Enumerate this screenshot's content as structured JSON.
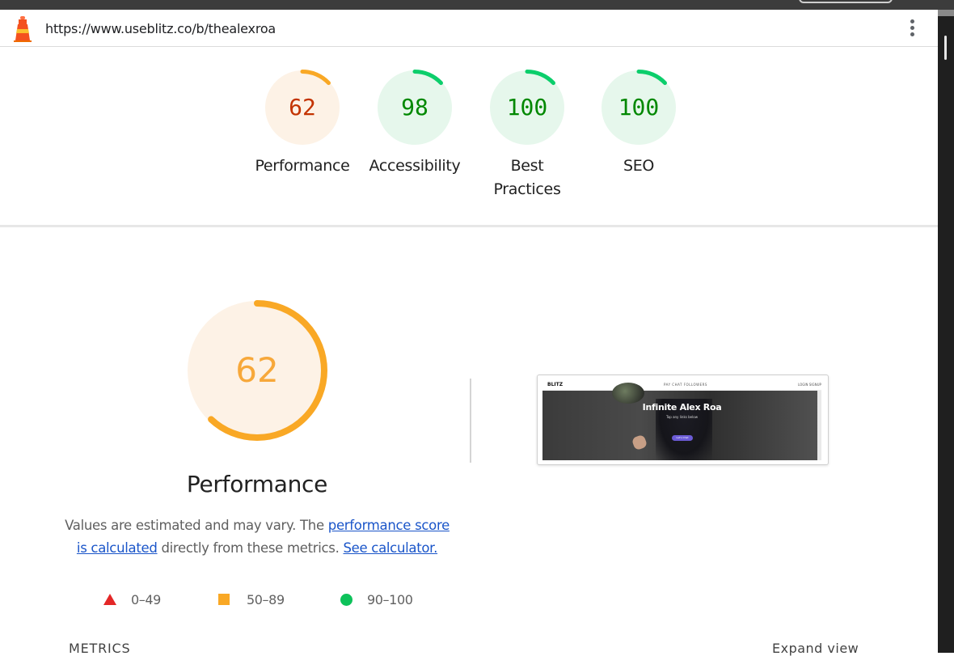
{
  "url": "https://www.useblitz.co/b/thealexroa",
  "icons": {
    "logo": "lighthouse-icon",
    "menu": "kebab-menu-icon"
  },
  "colors": {
    "average": "#f9a825",
    "pass": "#0cce6b",
    "fail": "#e32727",
    "link": "#1a55c9"
  },
  "categories": [
    {
      "id": "performance",
      "score": "62",
      "value": 62,
      "label": "Performance",
      "status": "average",
      "ring_color": "#f9a825",
      "bg": "#fdf2e6",
      "text_color": "#c33300"
    },
    {
      "id": "accessibility",
      "score": "98",
      "value": 98,
      "label": "Accessibility",
      "status": "pass",
      "ring_color": "#0cce6b",
      "bg": "#e6f7ec",
      "text_color": "#008800"
    },
    {
      "id": "best-practices",
      "score": "100",
      "value": 100,
      "label": "Best Practices",
      "status": "pass",
      "ring_color": "#0cce6b",
      "bg": "#e6f7ec",
      "text_color": "#008800"
    },
    {
      "id": "seo",
      "score": "100",
      "value": 100,
      "label": "SEO",
      "status": "pass",
      "ring_color": "#0cce6b",
      "bg": "#e6f7ec",
      "text_color": "#008800"
    }
  ],
  "performance": {
    "score": "62",
    "value": 62,
    "title": "Performance",
    "desc_prefix": "Values are estimated and may vary. The ",
    "desc_link1": "performance score is calculated",
    "desc_middle": " directly from these metrics. ",
    "desc_link2": "See calculator."
  },
  "legend": [
    {
      "range": "0–49",
      "icon": "fail-triangle-icon"
    },
    {
      "range": "50–89",
      "icon": "average-square-icon"
    },
    {
      "range": "90–100",
      "icon": "pass-circle-icon"
    }
  ],
  "screenshot": {
    "brand": "BLITZ",
    "nav_links": "PAY   CHAT   FOLLOWERS",
    "nav_right": "LOGIN   SIGNUP",
    "hero_title": "Infinite Alex Roa",
    "hero_sub": "Tap any links below",
    "hero_button": "Let's Chat"
  },
  "metrics": {
    "title": "METRICS",
    "expand_label": "Expand view"
  }
}
